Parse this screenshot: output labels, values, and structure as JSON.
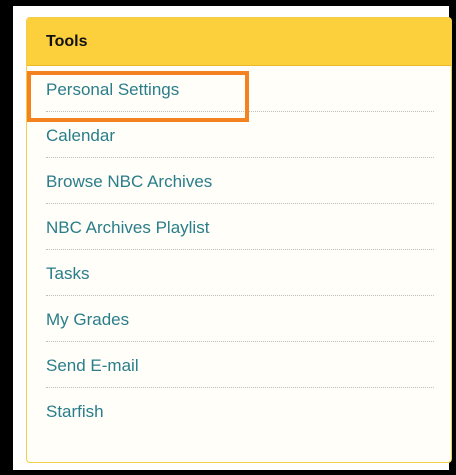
{
  "panel": {
    "title": "Tools",
    "items": [
      {
        "label": "Personal Settings"
      },
      {
        "label": "Calendar"
      },
      {
        "label": "Browse NBC Archives"
      },
      {
        "label": "NBC Archives Playlist"
      },
      {
        "label": "Tasks"
      },
      {
        "label": "My Grades"
      },
      {
        "label": "Send E-mail"
      },
      {
        "label": "Starfish"
      }
    ]
  },
  "colors": {
    "header_background": "#fccf3c",
    "link_text": "#2a7d8a",
    "highlight_outline": "#f58220",
    "outer_frame": "#000000"
  }
}
